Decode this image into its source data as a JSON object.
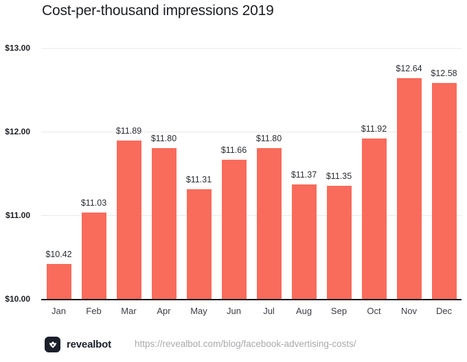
{
  "chart_data": {
    "type": "bar",
    "title": "Cost-per-thousand impressions 2019",
    "xlabel": "",
    "ylabel": "",
    "ylim": [
      10.0,
      13.0
    ],
    "grid": true,
    "legend": false,
    "bar_color": "#f96b5b",
    "categories": [
      "Jan",
      "Feb",
      "Mar",
      "Apr",
      "May",
      "Jun",
      "Jul",
      "Aug",
      "Sep",
      "Oct",
      "Nov",
      "Dec"
    ],
    "values": [
      10.42,
      11.03,
      11.89,
      11.8,
      11.31,
      11.66,
      11.8,
      11.37,
      11.35,
      11.92,
      12.64,
      12.58
    ],
    "value_labels": [
      "$10.42",
      "$11.03",
      "$11.89",
      "$11.80",
      "$11.31",
      "$11.66",
      "$11.80",
      "$11.37",
      "$11.35",
      "$11.92",
      "$12.64",
      "$12.58"
    ],
    "y_ticks": [
      10.0,
      11.0,
      12.0,
      13.0
    ],
    "y_tick_labels": [
      "$10.00",
      "$11.00",
      "$12.00",
      "$13.00"
    ]
  },
  "footer": {
    "logo_icon": "revealbot-crown-logo-icon",
    "brand": "revealbot",
    "url": "https://revealbot.com/blog/facebook-advertising-costs/"
  }
}
